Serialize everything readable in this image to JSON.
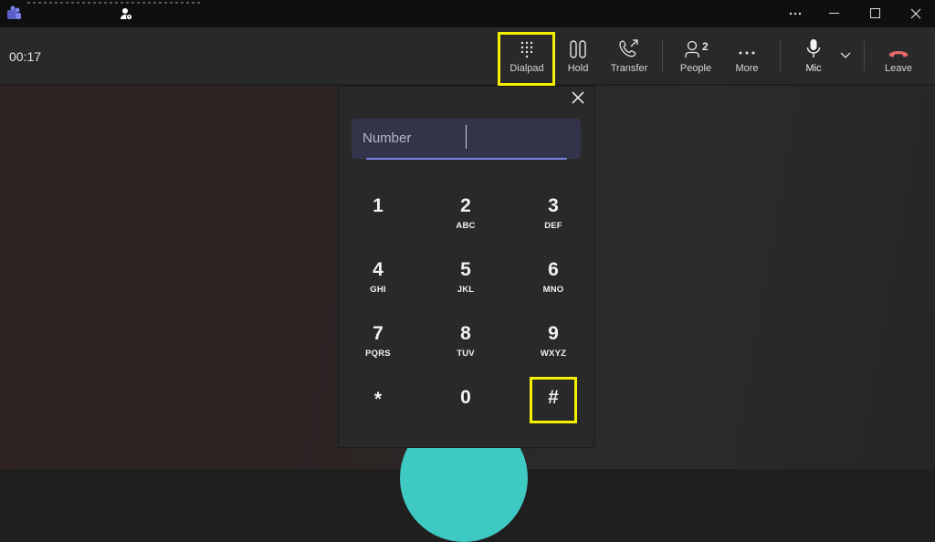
{
  "titlebar": {
    "icons": [
      "teams-logo",
      "presence-icon",
      "more-icon",
      "minimize-icon",
      "maximize-icon",
      "close-icon"
    ]
  },
  "toolbar": {
    "timer": "00:17",
    "dialpad_label": "Dialpad",
    "hold_label": "Hold",
    "transfer_label": "Transfer",
    "people_label": "People",
    "people_count": "2",
    "more_label": "More",
    "mic_label": "Mic",
    "leave_label": "Leave"
  },
  "dialpad": {
    "number_placeholder": "Number",
    "number_value": "",
    "keys": [
      {
        "digit": "1",
        "letters": ""
      },
      {
        "digit": "2",
        "letters": "ABC"
      },
      {
        "digit": "3",
        "letters": "DEF"
      },
      {
        "digit": "4",
        "letters": "GHI"
      },
      {
        "digit": "5",
        "letters": "JKL"
      },
      {
        "digit": "6",
        "letters": "MNO"
      },
      {
        "digit": "7",
        "letters": "PQRS"
      },
      {
        "digit": "8",
        "letters": "TUV"
      },
      {
        "digit": "9",
        "letters": "WXYZ"
      },
      {
        "digit": "*",
        "letters": ""
      },
      {
        "digit": "0",
        "letters": ""
      },
      {
        "digit": "#",
        "letters": ""
      }
    ]
  },
  "colors": {
    "highlight": "#f5f000",
    "leave": "#e8696a",
    "accent": "#7b83eb",
    "avatar": "#3fc9c3"
  }
}
